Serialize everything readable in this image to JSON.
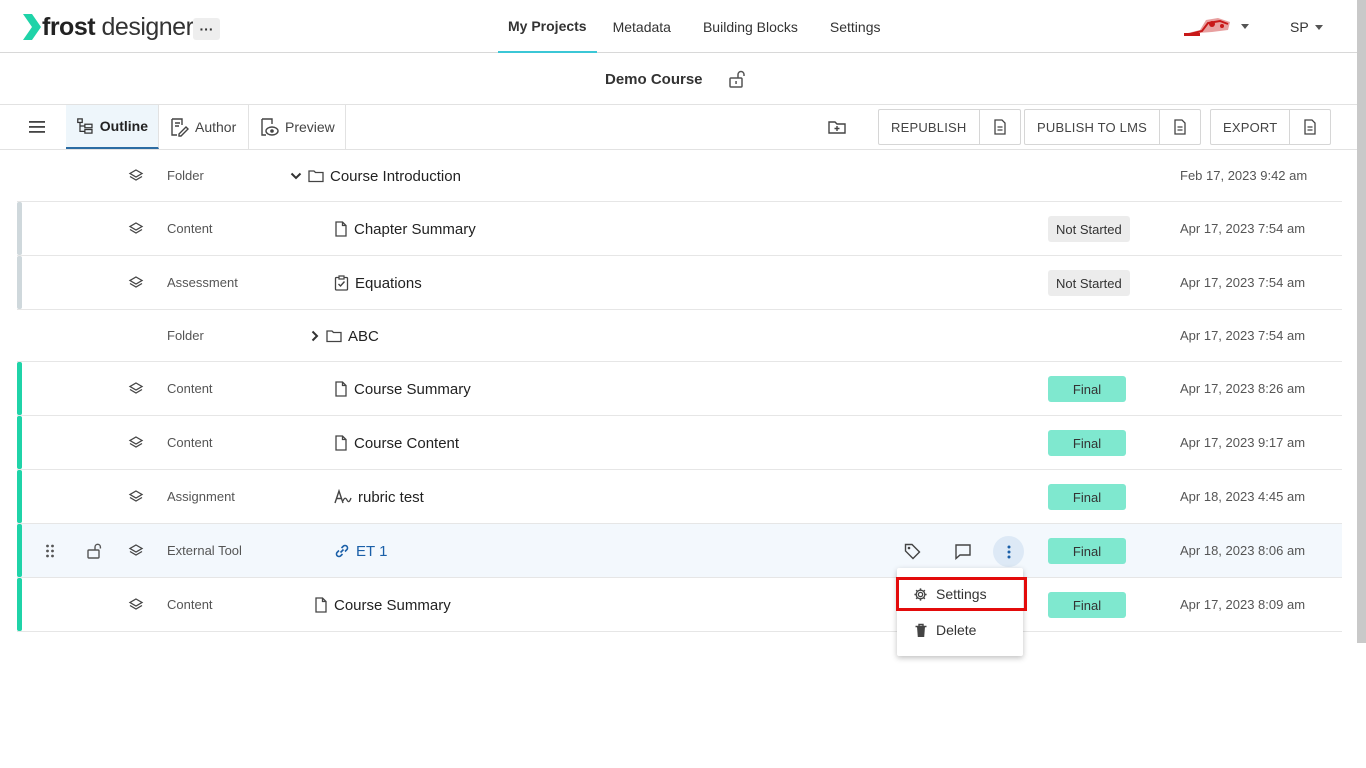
{
  "app": {
    "brand_bold": "frost",
    "brand_rest": " designer",
    "more_label": "···"
  },
  "nav": {
    "items": [
      "My Projects",
      "Metadata",
      "Building Blocks",
      "Settings"
    ],
    "active": "My Projects"
  },
  "user": {
    "initials": "SP"
  },
  "course": {
    "title": "Demo Course"
  },
  "toolbar": {
    "tabs": [
      "Outline",
      "Author",
      "Preview"
    ],
    "republish": "REPUBLISH",
    "publish_lms": "PUBLISH TO LMS",
    "export": "EXPORT"
  },
  "rows": [
    {
      "type": "Folder",
      "name": "Course Introduction",
      "icon": "folder-icon",
      "expander": "chevron-down-icon",
      "status": "",
      "date": "Feb 17, 2023 9:42 am",
      "bar": "none"
    },
    {
      "type": "Content",
      "name": "Chapter Summary",
      "icon": "document-icon",
      "status": "Not Started",
      "date": "Apr 17, 2023 7:54 am",
      "bar": "#cfd8dc"
    },
    {
      "type": "Assessment",
      "name": "Equations",
      "icon": "checklist-icon",
      "status": "Not Started",
      "date": "Apr 17, 2023 7:54 am",
      "bar": "#cfd8dc"
    },
    {
      "type": "Folder",
      "name": "ABC",
      "icon": "folder-icon",
      "expander": "chevron-right-icon",
      "status": "",
      "date": "Apr 17, 2023 7:54 am",
      "bar": "none"
    },
    {
      "type": "Content",
      "name": "Course Summary",
      "icon": "document-icon",
      "status": "Final",
      "date": "Apr 17, 2023 8:26 am",
      "bar": "#1fd3a8"
    },
    {
      "type": "Content",
      "name": "Course Content",
      "icon": "document-icon",
      "status": "Final",
      "date": "Apr 17, 2023 9:17 am",
      "bar": "#1fd3a8"
    },
    {
      "type": "Assignment",
      "name": "rubric test",
      "icon": "assignment-icon",
      "status": "Final",
      "date": "Apr 18, 2023 4:45 am",
      "bar": "#1fd3a8"
    },
    {
      "type": "External Tool",
      "name": "ET 1",
      "icon": "link-icon",
      "status": "Final",
      "date": "Apr 18, 2023 8:06 am",
      "bar": "#1fd3a8"
    },
    {
      "type": "Content",
      "name": "Course Summary",
      "icon": "document-icon",
      "status": "Final",
      "date": "Apr 17, 2023 8:09 am",
      "bar": "#1fd3a8"
    }
  ],
  "menu": {
    "items": [
      "Settings",
      "Delete"
    ]
  },
  "colors": {
    "accent": "#3bc7d6",
    "final": "#7fe8cf",
    "final_bar": "#1fd3a8",
    "link": "#1a5fa8",
    "highlight": "#e30b0b"
  }
}
